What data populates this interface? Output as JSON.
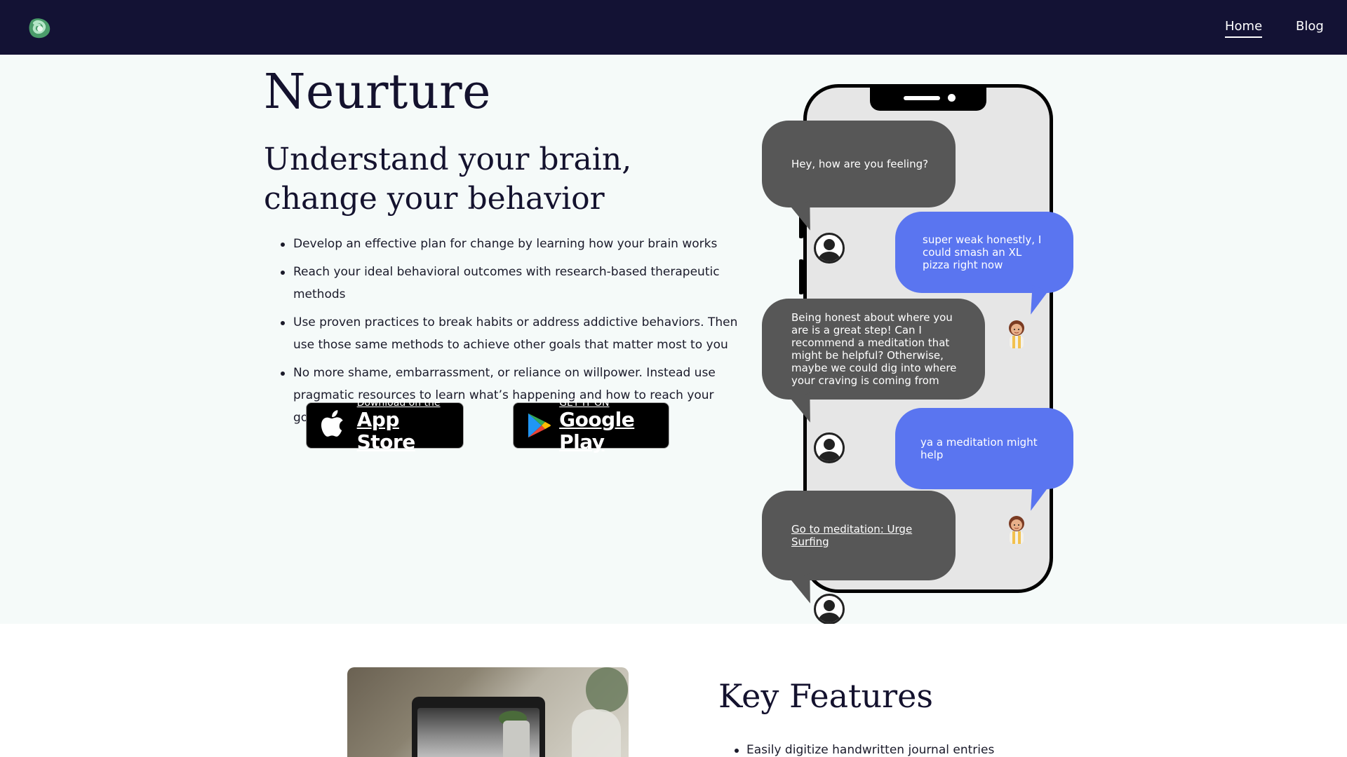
{
  "nav": {
    "logo_icon": "neurture-logo-icon",
    "home_label": "Home",
    "blog_label": "Blog"
  },
  "hero": {
    "title": "Neurture",
    "subtitle": "Understand your brain, change your behavior",
    "benefits": [
      "Develop an effective plan for change by learning how your brain works",
      "Reach your ideal behavioral outcomes with research-based therapeutic methods",
      "Use proven practices to break habits or address addictive behaviors. Then use those same methods to achieve other goals that matter most to you",
      "No more shame, embarrassment, or reliance on willpower. Instead use pragmatic resources to learn what’s happening and how to reach your goals"
    ],
    "app_store": {
      "small_text": "Download on the",
      "large_text": "App Store",
      "icon": "apple-icon"
    },
    "google_play": {
      "small_text": "GET IT ON",
      "large_text": "Google Play",
      "icon": "google-play-icon"
    }
  },
  "chat": {
    "messages": [
      {
        "sender": "bot",
        "text": "Hey, how are you feeling?"
      },
      {
        "sender": "user",
        "text": "super weak honestly, I could smash an XL pizza right now"
      },
      {
        "sender": "bot",
        "text": "Being honest about where you are is a great step! Can I recommend a meditation that might be helpful? Otherwise, maybe we could dig into where your craving is coming from"
      },
      {
        "sender": "user",
        "text": "ya a meditation might help"
      },
      {
        "sender": "bot",
        "text": "Go to meditation: Urge Surfing",
        "is_link": true
      }
    ],
    "colors": {
      "bot_bubble": "#575757",
      "user_bubble": "#5a75f0",
      "phone_screen": "#e6e6e6"
    }
  },
  "features": {
    "title": "Key Features",
    "items": [
      "Easily digitize handwritten journal entries"
    ]
  },
  "colors": {
    "navbar": "#131234",
    "hero_background": "#f5faf9",
    "text": "#14122e"
  }
}
